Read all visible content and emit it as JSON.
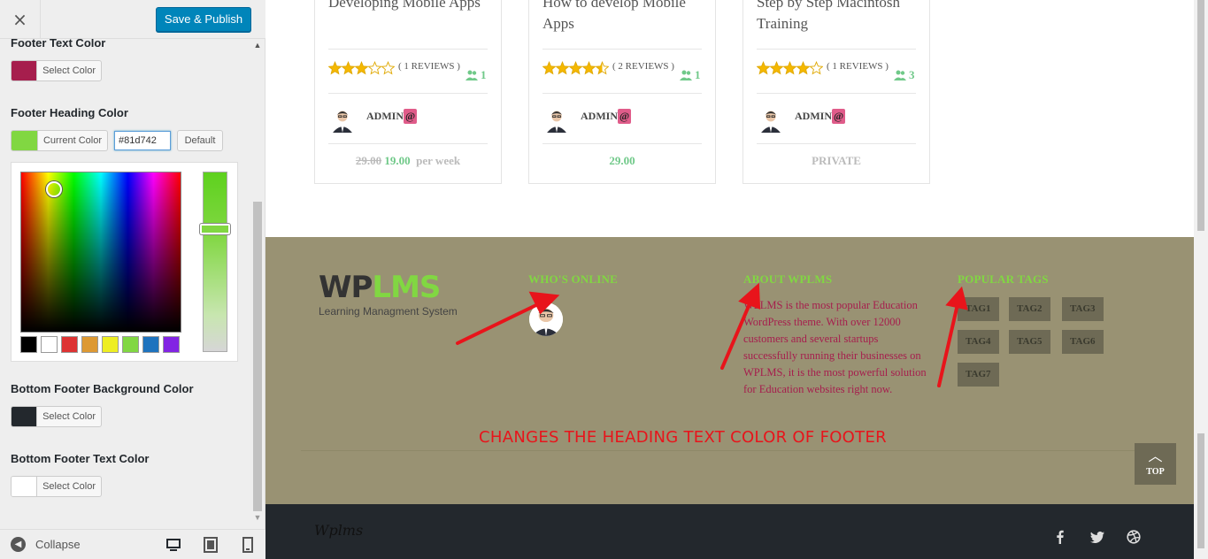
{
  "sidebar": {
    "close_icon": "×",
    "publish_label": "Save & Publish",
    "footer_text_color": {
      "title": "Footer Text Color",
      "button_label": "Select Color",
      "swatch": "#a61e4d"
    },
    "footer_heading_color": {
      "title": "Footer Heading Color",
      "button_label": "Current Color",
      "swatch": "#81d742",
      "hex_value": "#81d742",
      "default_label": "Default"
    },
    "palette": [
      "#000000",
      "#ffffff",
      "#dd3333",
      "#dd9933",
      "#eeee22",
      "#81d742",
      "#1e73be",
      "#8224e3"
    ],
    "bottom_footer_bg": {
      "title": "Bottom Footer Background Color",
      "button_label": "Select Color",
      "swatch": "#23282d"
    },
    "bottom_footer_text": {
      "title": "Bottom Footer Text Color",
      "button_label": "Select Color",
      "swatch": "#ffffff"
    },
    "collapse_label": "Collapse"
  },
  "courses": [
    {
      "title": "Developing Mobile Apps",
      "reviews": "( 1 REVIEWS )",
      "rating": 3,
      "students": "1",
      "admin": "ADMIN",
      "old_price": "29.00",
      "price": "19.00",
      "per": "per week"
    },
    {
      "title": "How to develop Mobile Apps",
      "reviews": "( 2 REVIEWS )",
      "rating": 4.5,
      "students": "1",
      "admin": "ADMIN",
      "price": "29.00"
    },
    {
      "title": "Step by Step Macintosh Training",
      "reviews": "( 1 REVIEWS )",
      "rating": 4,
      "students": "3",
      "admin": "ADMIN",
      "price_label": "PRIVATE"
    }
  ],
  "at_symbol": "@",
  "currency_glyph": "",
  "footer": {
    "logo_wp": "WP",
    "logo_lms": "LMS",
    "logo_tagline": "Learning Managment System",
    "who_online": "WHO'S ONLINE",
    "about_heading": "ABOUT WPLMS",
    "about_text": "WPLMS is the most popular Education WordPress theme. With over 12000 customers and several startups successfully running their businesses on WPLMS, it is the most powerful solution for Education websites right now.",
    "tags_heading": "POPULAR TAGS",
    "tags": [
      "TAG1",
      "TAG2",
      "TAG3",
      "TAG4",
      "TAG5",
      "TAG6",
      "TAG7"
    ],
    "annotation": "CHANGES THE HEADING TEXT COLOR OF FOOTER",
    "top_label": "TOP",
    "brand": "Wplms",
    "heading_color": "#81d742",
    "bg_color": "#999273",
    "annotation_color": "#e8141b"
  }
}
